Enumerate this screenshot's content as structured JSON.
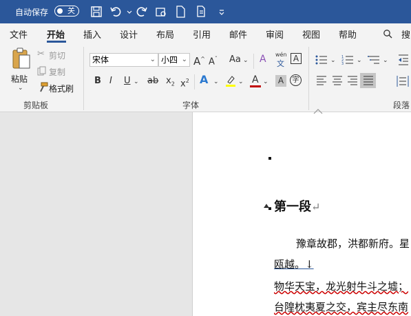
{
  "titlebar": {
    "autosave_label": "自动保存",
    "autosave_state": "关"
  },
  "tabs": [
    "文件",
    "开始",
    "插入",
    "设计",
    "布局",
    "引用",
    "邮件",
    "审阅",
    "视图",
    "帮助",
    "搜"
  ],
  "ribbon": {
    "clipboard": {
      "paste": "粘贴",
      "cut": "剪切",
      "copy": "复制",
      "format_painter": "格式刷",
      "group_label": "剪贴板"
    },
    "font": {
      "font_name": "宋体",
      "font_size": "小四",
      "phonetic_small": "wén",
      "phonetic_char": "文",
      "group_label": "字体"
    },
    "paragraph": {
      "group_label": "段落"
    }
  },
  "document": {
    "heading": "第一段",
    "line1": "豫章故郡，洪都新府。星",
    "line2": "瓯越。↓",
    "line3_a": "物华天宝，龙光射牛斗之墟；",
    "line4": "台隍枕夷夏之交，宾主尽东南"
  },
  "colors": {
    "titlebar": "#2b579a",
    "highlight": "#ffff00",
    "font_color": "#c00000"
  }
}
